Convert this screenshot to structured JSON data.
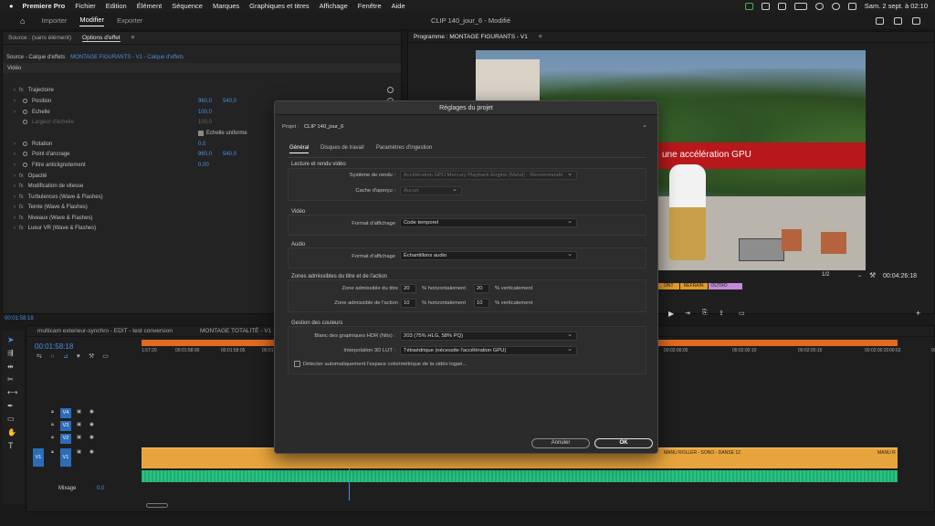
{
  "menubar": {
    "app": "Premiere Pro",
    "items": [
      "Fichier",
      "Edition",
      "Élément",
      "Séquence",
      "Marques",
      "Graphiques et titres",
      "Affichage",
      "Fenêtre",
      "Aide"
    ],
    "clock": "Sam. 2 sept. à 02:10"
  },
  "appbar": {
    "tabs": [
      "Importer",
      "Modifier",
      "Exporter"
    ],
    "active_tab": "Modifier",
    "doc_title": "CLIP 140_jour_6 - Modifié"
  },
  "effects_panel": {
    "tab_source": "Source : (sans élément)",
    "tab_options": "Options d'effet",
    "tab_menu": "≡",
    "source_line": "Source - Calque d'effets",
    "clip_line": "MONTAGE FIGURANTS - V1 - Calque d'effets",
    "section_video": "Vidéo",
    "rows": [
      {
        "fx": "fx",
        "name": "Trajectoire",
        "indent": 0
      },
      {
        "name": "Position",
        "v1": "960,0",
        "v2": "540,0"
      },
      {
        "name": "Echelle",
        "v1": "100,0"
      },
      {
        "name": "Largeur d'échelle",
        "v1": "100,0",
        "dim": true
      },
      {
        "name": "Echelle uniforme",
        "check": true
      },
      {
        "name": "Rotation",
        "v1": "0,0"
      },
      {
        "name": "Point d'ancrage",
        "v1": "960,0",
        "v2": "540,0"
      },
      {
        "name": "Filtre anticlignotement",
        "v1": "0,00"
      },
      {
        "fx": "fx",
        "name": "Opacité"
      },
      {
        "fx": "fx",
        "name": "Modification de vitesse"
      },
      {
        "fx": "fx",
        "name": "Turbulences (Wave & Flashes)"
      },
      {
        "fx": "fx",
        "name": "Teinte (Wave & Flashes)"
      },
      {
        "fx": "fx",
        "name": "Niveaux (Wave & Flashes)"
      },
      {
        "fx": "fx",
        "name": "Lueur VR (Wave & Flashes)"
      }
    ],
    "timecode": "00:01:58:18"
  },
  "program": {
    "tab": "Programme : MONTAGE FIGURANTS - V1",
    "tab_menu": "≡",
    "overlay_text": "une accélération GPU",
    "zoom": "1/2",
    "timecode": "00:04:26:18",
    "markers": [
      "ONT",
      "REFRAIN",
      "OUTRO"
    ]
  },
  "timeline": {
    "tabs": [
      "multicam exterieur-synchro - EDIT - test conversion",
      "MONTAGE TOTALITÉ - V1"
    ],
    "timecode": "00:01:58:18",
    "ruler": [
      "1:57:20",
      "00:01:58:00",
      "00:01:58:05",
      "00:01:58:10",
      "00:02:00:05",
      "00:02:00:10",
      "00:02:00:15",
      "00:02:00:20",
      "00:02:01:00",
      "00:02"
    ],
    "tracks": [
      "V4",
      "V3",
      "V2",
      "V1"
    ],
    "src_track": "V1",
    "clip_label": "MANU ROLLER - SONO - DANSE 12",
    "clip_label2": "MANU R",
    "mix_label": "Mixage",
    "mix_value": "0,0"
  },
  "dialog": {
    "title": "Réglages du projet",
    "project_label": "Projet :",
    "project_value": "CLIP 140_jour_6",
    "tabs": [
      "Général",
      "Disques de travail",
      "Paramètres d'ingestion"
    ],
    "active_tab": "Général",
    "s1": {
      "title": "Lecture et rendu vidéo",
      "renderer_label": "Système de rendu :",
      "renderer_value": "Accélération GPU Mercury Playback Engine (Metal) - Recommandé",
      "preview_label": "Cache d'aperçu :",
      "preview_value": "Aucun"
    },
    "s2": {
      "title": "Vidéo",
      "format_label": "Format d'affichage",
      "format_value": "Code temporel"
    },
    "s3": {
      "title": "Audio",
      "format_label": "Format d'affichage",
      "format_value": "Échantillons audio"
    },
    "s4": {
      "title": "Zones admissibles du titre et de l'action",
      "title_safe_label": "Zone admissible du titre",
      "title_h": "20",
      "title_v": "20",
      "action_safe_label": "Zone admissible de l'action",
      "action_h": "10",
      "action_v": "10",
      "h_unit": "% horizontalement",
      "v_unit": "% verticalement"
    },
    "s5": {
      "title": "Gestion des couleurs",
      "hdr_label": "Blanc des graphiques HDR (Nits) :",
      "hdr_value": "203 (75% HLG, 58% PQ)",
      "lut_label": "Interpolation 3D LUT :",
      "lut_value": "Tétraédrique (nécessite l'accélération GPU)",
      "auto_detect": "Détecter automatiquement l'espace colorimétrique de la vidéo logari..."
    },
    "cancel": "Annuler",
    "ok": "OK"
  }
}
